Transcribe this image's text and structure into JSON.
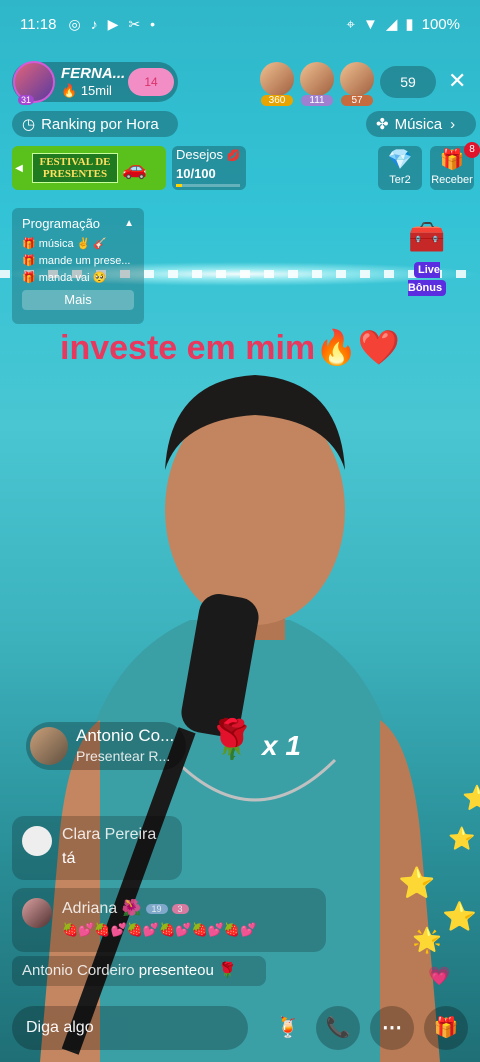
{
  "status_bar": {
    "time": "11:18",
    "battery": "100%"
  },
  "host": {
    "name": "FERNA...",
    "likes": "15mil",
    "level": "31",
    "badge": "14"
  },
  "viewers": [
    {
      "score": "360",
      "color": "#e8a400"
    },
    {
      "score": "111",
      "color": "#9e7fd0"
    },
    {
      "score": "57",
      "color": "#c66b3e"
    }
  ],
  "viewer_count": "59",
  "ranking_label": "Ranking por Hora",
  "music_label": "Música",
  "festival": {
    "title_line1": "FESTIVAL DE",
    "title_line2": "PRESENTES"
  },
  "desejos": {
    "label": "Desejos",
    "progress": "10/100",
    "fraction": 0.1
  },
  "side_buttons": {
    "ter2": "Ter2",
    "receber": "Receber",
    "receber_badge": "8"
  },
  "programacao": {
    "title": "Programação",
    "items": [
      "música ✌️ 🎸",
      "mande um prese...",
      "manda vai 🥺"
    ],
    "more_label": "Mais"
  },
  "live_bonus_label": "Live Bônus",
  "caption": "investe em mim🔥❤️",
  "gift_banner": {
    "sender": "Antonio Co...",
    "action": "Presentear R...",
    "count": "x 1"
  },
  "messages": [
    {
      "name": "Clara Pereira",
      "text": "tá"
    },
    {
      "name": "Adriana 🌺",
      "tag1": "19",
      "tag2": "3",
      "text": "🍓💕🍓💕🍓💕🍓💕🍓💕🍓💕"
    }
  ],
  "gift_notice": {
    "name": "Antonio Cordeiro",
    "verb": "presenteou",
    "gift": "🌹"
  },
  "input_placeholder": "Diga algo",
  "colors": {
    "accent": "#e8385e",
    "live_bonus": "#5a2ee0",
    "badge_red": "#e0152b"
  }
}
